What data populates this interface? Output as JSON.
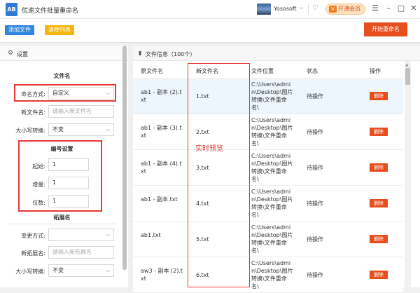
{
  "window": {
    "logo_text": "AB",
    "title": "优速文件批量重命名",
    "user_name": "Yososoft",
    "vip_label": "开通会员",
    "vip_icon": "V",
    "controls": [
      "☰",
      "–",
      "□",
      "✕"
    ]
  },
  "toolbar": {
    "add_label": "添加文件",
    "clear_label": "清除列表",
    "start_label": "开始重命名"
  },
  "settings": {
    "title": "设置",
    "filename": {
      "title": "文件名",
      "mode_label": "命名方式:",
      "mode_value": "自定义",
      "new_name_label": "新文件名:",
      "new_name_placeholder": "请输入新文件名",
      "case_label": "大小写转换:",
      "case_value": "不变"
    },
    "numbering": {
      "title": "编号设置",
      "start_label": "起始:",
      "start_value": "1",
      "step_label": "增量:",
      "step_value": "1",
      "digits_label": "位数:",
      "digits_value": "1"
    },
    "extension": {
      "title": "拓展名",
      "change_label": "变更方式:",
      "change_value": "",
      "new_ext_label": "新拓展名:",
      "new_ext_placeholder": "请输入新拓展名",
      "case_label": "大小写转换:",
      "case_value": "不变"
    }
  },
  "files": {
    "title": "文件信息（100个）",
    "columns": [
      "原文件名",
      "新文件名",
      "文件位置",
      "状态",
      "操作"
    ],
    "preview_label": "实时预览",
    "rows": [
      {
        "orig": [
          "ab1 - 副本 (2).t",
          "xt"
        ],
        "new": "1.txt",
        "loc": [
          "C:\\Users\\admi",
          "n\\Desktop\\图片",
          "转换\\文件重命",
          "名\\"
        ],
        "status": "待操作",
        "action": "删除"
      },
      {
        "orig": [
          "ab1 - 副本 (3).t",
          "xt"
        ],
        "new": "2.txt",
        "loc": [
          "C:\\Users\\admi",
          "n\\Desktop\\图片",
          "转换\\文件重命",
          "名\\"
        ],
        "status": "待操作",
        "action": "删除"
      },
      {
        "orig": [
          "ab1 - 副本 (4).t",
          "xt"
        ],
        "new": "3.txt",
        "loc": [
          "C:\\Users\\admi",
          "n\\Desktop\\图片",
          "转换\\文件重命",
          "名\\"
        ],
        "status": "待操作",
        "action": "删除"
      },
      {
        "orig": [
          "ab1 - 副本.txt",
          ""
        ],
        "new": "4.txt",
        "loc": [
          "C:\\Users\\admi",
          "n\\Desktop\\图片",
          "转换\\文件重命",
          "名\\"
        ],
        "status": "待操作",
        "action": "删除"
      },
      {
        "orig": [
          "ab1.txt",
          ""
        ],
        "new": "5.txt",
        "loc": [
          "C:\\Users\\admi",
          "n\\Desktop\\图片",
          "转换\\文件重命",
          "名\\"
        ],
        "status": "待操作",
        "action": "删除"
      },
      {
        "orig": [
          "aw3 - 副本 (2).t",
          "xt"
        ],
        "new": "6.txt",
        "loc": [
          "C:\\Users\\admi",
          "n\\Desktop\\图片",
          "转换\\文件重命",
          "名\\"
        ],
        "status": "待操作",
        "action": "删除"
      }
    ]
  }
}
